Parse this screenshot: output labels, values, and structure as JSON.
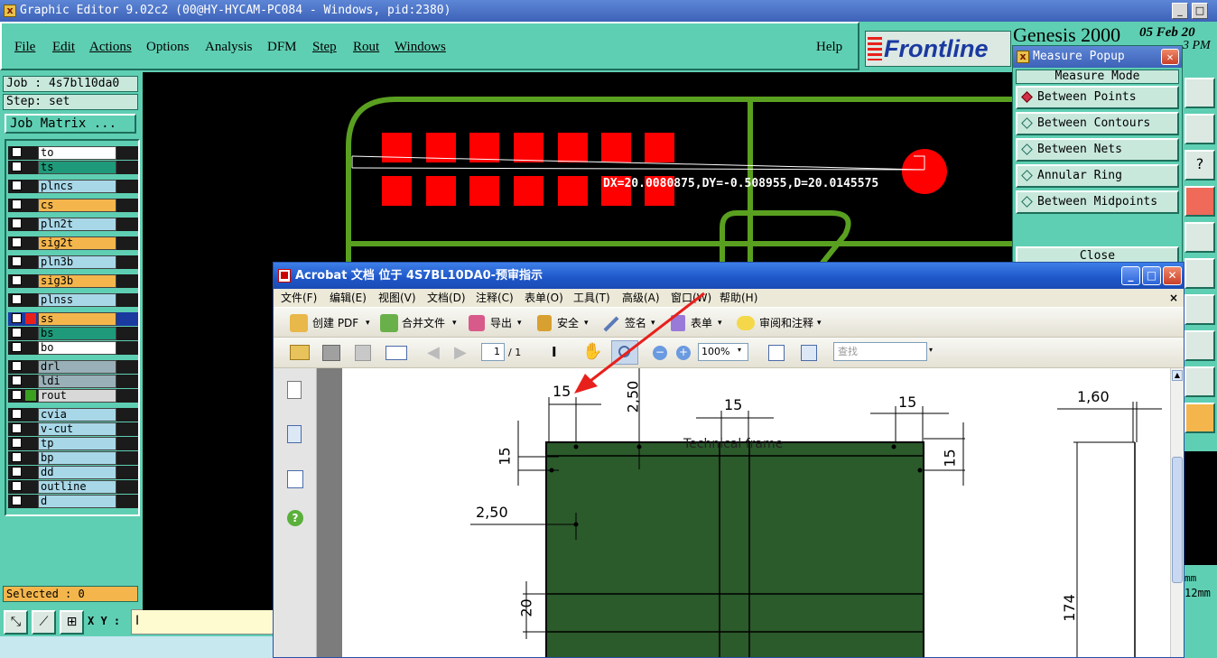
{
  "window": {
    "title": "Graphic Editor 9.02c2 (00@HY-HYCAM-PC084 - Windows, pid:2380)",
    "min": "_",
    "max": "□"
  },
  "menu": [
    "File",
    "Edit",
    "Actions",
    "Options",
    "Analysis",
    "DFM",
    "Step",
    "Rout",
    "Windows"
  ],
  "help": "Help",
  "brand": {
    "logo": "Frontline",
    "product": "Genesis 2000",
    "date": "05 Feb 20",
    "time": "3 PM"
  },
  "job": {
    "job_line": "Job : 4s7bl10da0",
    "step_line": "Step: set",
    "matrix_button": "Job Matrix ..."
  },
  "layers": [
    "to",
    "ts",
    "plncs",
    "cs",
    "pln2t",
    "sig2t",
    "pln3b",
    "sig3b",
    "plnss",
    "ss",
    "bs",
    "bo",
    "drl",
    "ldi",
    "rout",
    "cvia",
    "v-cut",
    "tp",
    "bp",
    "dd",
    "outline",
    "d"
  ],
  "selected": "Selected : 0",
  "xy_label": "X Y :",
  "measurement": "DX=20.0080875,DY=-0.508955,D=20.0145575",
  "measure_popup": {
    "title": "Measure Popup",
    "mode_label": "Measure Mode",
    "options": [
      "Between Points",
      "Between Contours",
      "Between Nets",
      "Annular Ring",
      "Between Midpoints"
    ],
    "active": "Between Points",
    "close": "Close"
  },
  "right_status": {
    "unit": "mm",
    "value": "12mm"
  },
  "acrobat": {
    "title": "Acrobat 文档 位于 4S7BL10DA0-预审指示",
    "menu": [
      "文件(F)",
      "编辑(E)",
      "视图(V)",
      "文档(D)",
      "注释(C)",
      "表单(O)",
      "工具(T)",
      "高级(A)",
      "窗口(W)",
      "帮助(H)"
    ],
    "toolbar": [
      "创建 PDF",
      "合并文件",
      "导出",
      "安全",
      "签名",
      "表单",
      "审阅和注释"
    ],
    "page_current": "1",
    "page_total": "/ 1",
    "zoom": "100%",
    "search_placeholder": "查找",
    "drawing_labels": {
      "d1": "15",
      "d2": "2,50",
      "d3": "15",
      "d4": "15",
      "d5": "1,60",
      "d6": "15",
      "d7": "15",
      "d8": "2,50",
      "d9": "20",
      "d10": "174",
      "frame": "Technical frame"
    }
  },
  "colors": {
    "panel": "#5fcfb3",
    "pad": "#ff0000",
    "outline": "#5aa020",
    "board": "#2b5a2b",
    "arrow": "#e8201c"
  }
}
